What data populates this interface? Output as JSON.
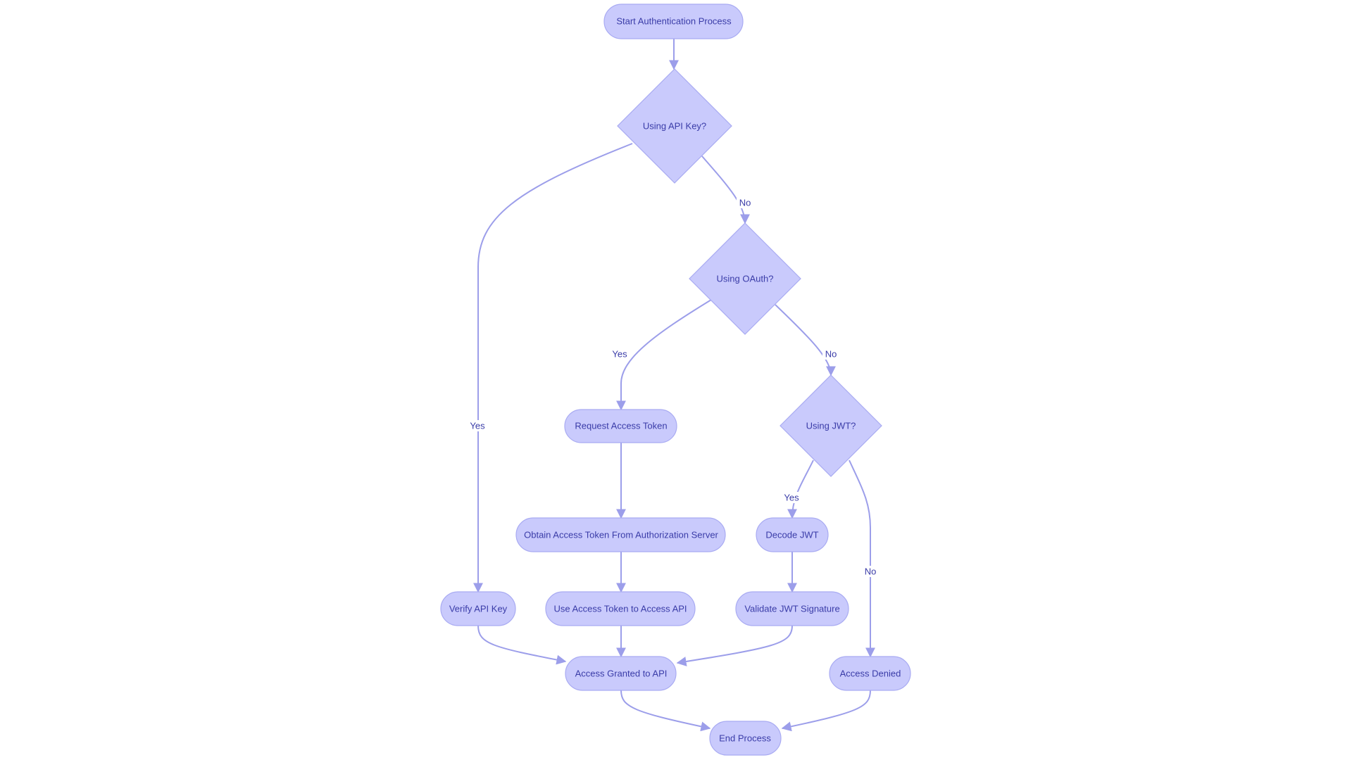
{
  "colors": {
    "node_fill": "#c9cafc",
    "node_stroke": "#a9abf2",
    "edge": "#9c9eea",
    "text": "#3a3ca8"
  },
  "nodes": {
    "start": "Start Authentication Process",
    "using_api_key": "Using API Key?",
    "using_oauth": "Using OAuth?",
    "using_jwt": "Using JWT?",
    "request_access_token": "Request Access Token",
    "obtain_access_token": "Obtain Access Token From Authorization Server",
    "verify_api_key": "Verify API Key",
    "use_access_token": "Use Access Token to Access API",
    "decode_jwt": "Decode JWT",
    "validate_jwt": "Validate JWT Signature",
    "access_granted": "Access Granted to API",
    "access_denied": "Access Denied",
    "end": "End Process"
  },
  "edge_labels": {
    "api_key_no": "No",
    "api_key_yes": "Yes",
    "oauth_yes": "Yes",
    "oauth_no": "No",
    "jwt_yes": "Yes",
    "jwt_no": "No"
  }
}
